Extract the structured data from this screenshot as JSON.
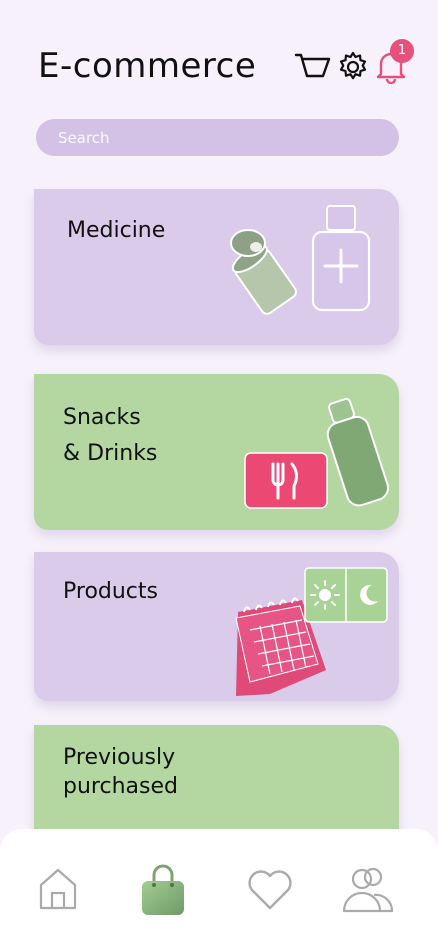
{
  "header": {
    "title": "E-commerce",
    "notification_count": "1",
    "icons": [
      "cart-icon",
      "gear-icon",
      "bell-icon"
    ]
  },
  "search": {
    "placeholder": "Search"
  },
  "categories": [
    {
      "label": "Medicine",
      "color": "#dacbea"
    },
    {
      "label": "Snacks\n& Drinks",
      "color": "#b4d7a2"
    },
    {
      "label": "Products",
      "color": "#dacbea"
    },
    {
      "label": "Previously\npurchased",
      "color": "#b4d7a2"
    }
  ],
  "nav": {
    "items": [
      "home-icon",
      "shopping-bag-icon",
      "heart-icon",
      "users-icon"
    ],
    "active": "shopping-bag-icon"
  },
  "colors": {
    "accent_pink": "#e8507c",
    "lavender": "#dacbea",
    "green": "#b4d7a2"
  }
}
